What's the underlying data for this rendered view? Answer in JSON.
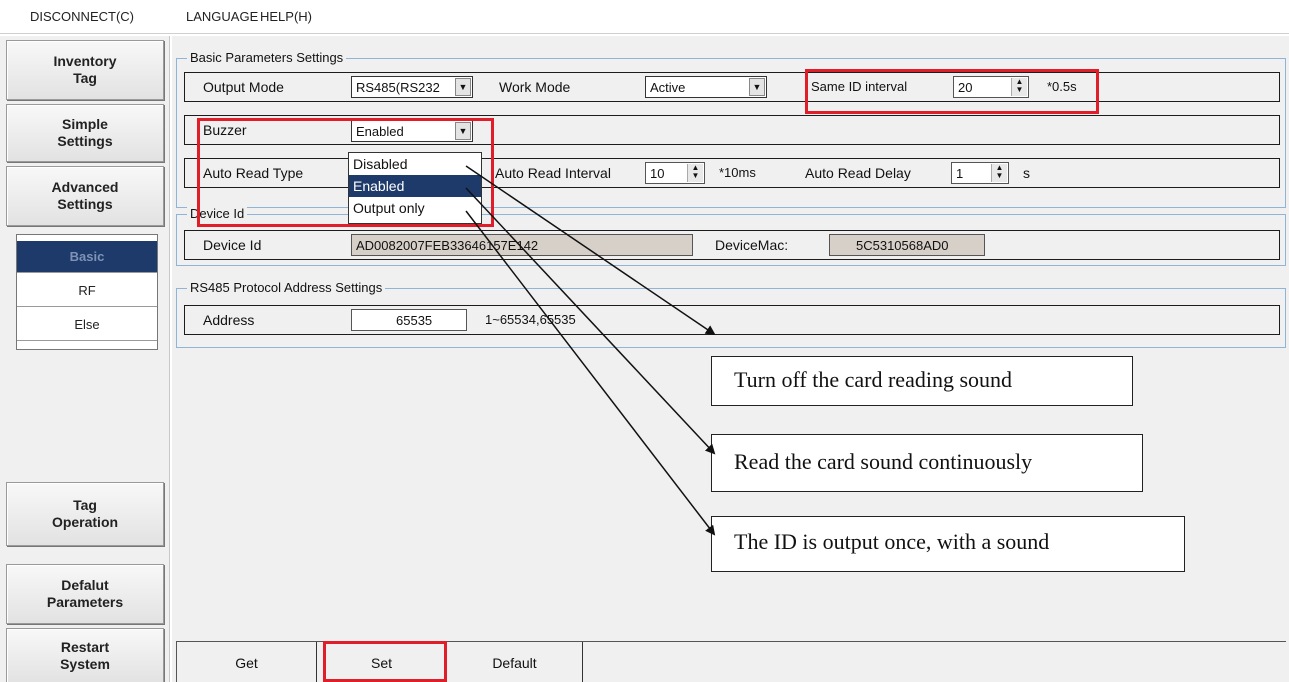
{
  "menu": {
    "disconnect": "DISCONNECT(C)",
    "language": "LANGUAGE",
    "help": "HELP(H)"
  },
  "sidebar": {
    "inventory_tag": "Inventory\nTag",
    "simple_settings": "Simple\nSettings",
    "advanced_settings": "Advanced\nSettings",
    "sub_items": [
      "Basic",
      "RF",
      "Else"
    ],
    "tag_operation": "Tag\nOperation",
    "default_parameters": "Defalut\nParameters",
    "restart_system": "Restart\nSystem"
  },
  "basic": {
    "group_title": "Basic Parameters Settings",
    "output_mode_label": "Output Mode",
    "output_mode_value": "RS485(RS232",
    "work_mode_label": "Work Mode",
    "work_mode_value": "Active",
    "same_id_label": "Same ID interval",
    "same_id_value": "20",
    "same_id_unit": "*0.5s",
    "buzzer_label": "Buzzer",
    "buzzer_value": "Enabled",
    "auto_read_type_label": "Auto Read Type",
    "auto_read_interval_label": "Auto Read Interval",
    "auto_read_interval_value": "10",
    "auto_read_interval_unit": "*10ms",
    "auto_read_delay_label": "Auto Read Delay",
    "auto_read_delay_value": "1",
    "auto_read_delay_unit": "s"
  },
  "buzzer_options": [
    "Disabled",
    "Enabled",
    "Output only"
  ],
  "device": {
    "group_title": "Device Id",
    "device_id_label": "Device Id",
    "device_id_value": "AD0082007FEB33646157E142",
    "mac_label": "DeviceMac:",
    "mac_value": "5C5310568AD0"
  },
  "rs485": {
    "group_title": "RS485 Protocol Address Settings",
    "address_label": "Address",
    "address_value": "65535",
    "address_range": "1~65534,65535"
  },
  "callouts": [
    "Turn off the card reading sound",
    "Read the card sound continuously",
    "The ID is output once, with a sound"
  ],
  "bottom_tabs": {
    "get": "Get",
    "set": "Set",
    "default": "Default"
  },
  "colors": {
    "highlight_red": "#e01e2a",
    "selected_blue": "#1e3a6a",
    "group_border": "#8fb4d8"
  }
}
